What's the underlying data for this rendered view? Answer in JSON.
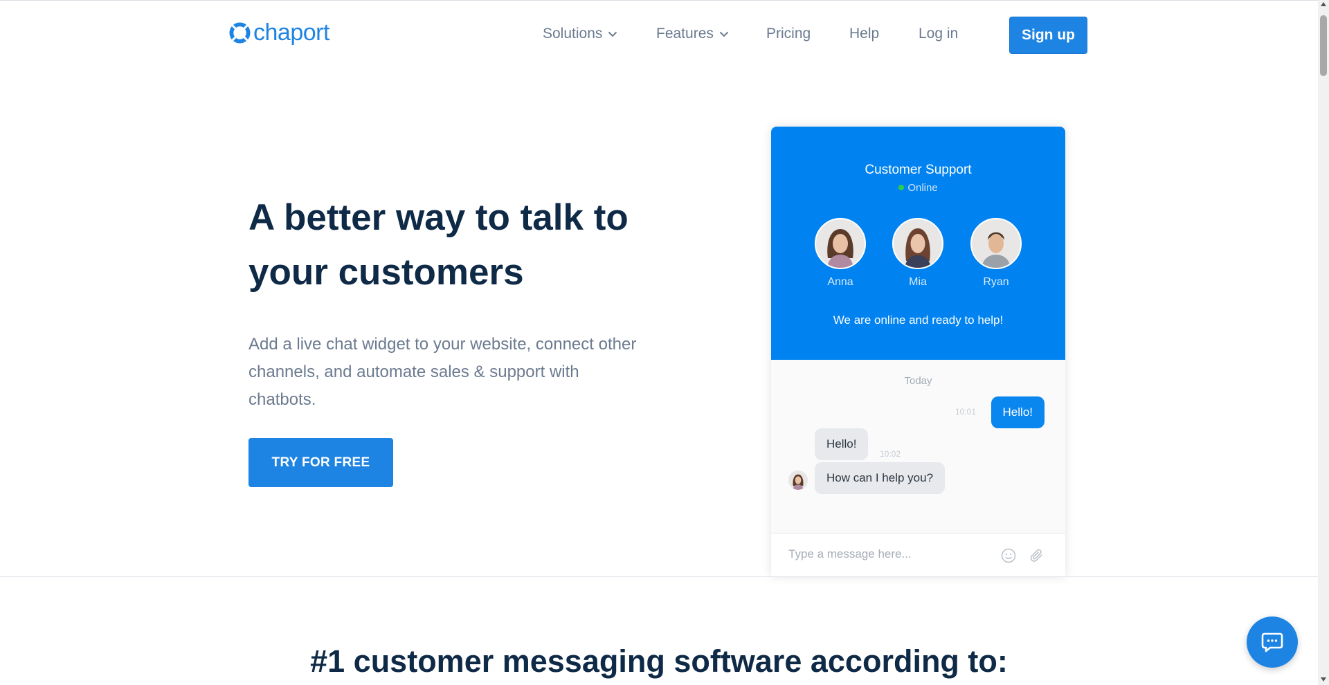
{
  "brand": {
    "name": "chaport",
    "color": "#1e84e3"
  },
  "nav": {
    "items": [
      {
        "label": "Solutions",
        "has_dropdown": true
      },
      {
        "label": "Features",
        "has_dropdown": true
      },
      {
        "label": "Pricing",
        "has_dropdown": false
      },
      {
        "label": "Help",
        "has_dropdown": false
      },
      {
        "label": "Log in",
        "has_dropdown": false
      }
    ],
    "signup_label": "Sign up"
  },
  "hero": {
    "title": "A better way to talk to your customers",
    "subtitle": "Add a live chat widget to your website, connect other channels, and automate sales & support with chatbots.",
    "cta_label": "TRY FOR FREE"
  },
  "widget": {
    "title": "Customer Support",
    "status": "Online",
    "agents": [
      {
        "name": "Anna"
      },
      {
        "name": "Mia"
      },
      {
        "name": "Ryan"
      }
    ],
    "ready_text": "We are online and ready to help!",
    "day_label": "Today",
    "messages": [
      {
        "direction": "out",
        "text": "Hello!",
        "time": "10:01"
      },
      {
        "direction": "in",
        "text": "Hello!",
        "time": "10:02"
      },
      {
        "direction": "in",
        "text": "How can I help you?",
        "time": ""
      }
    ],
    "input_placeholder": "Type a message here...",
    "header_color": "#0083f0",
    "online_color": "#27d045"
  },
  "section": {
    "title": "#1 customer messaging software according to:"
  },
  "launcher": {
    "icon": "chat-bubble-icon"
  }
}
